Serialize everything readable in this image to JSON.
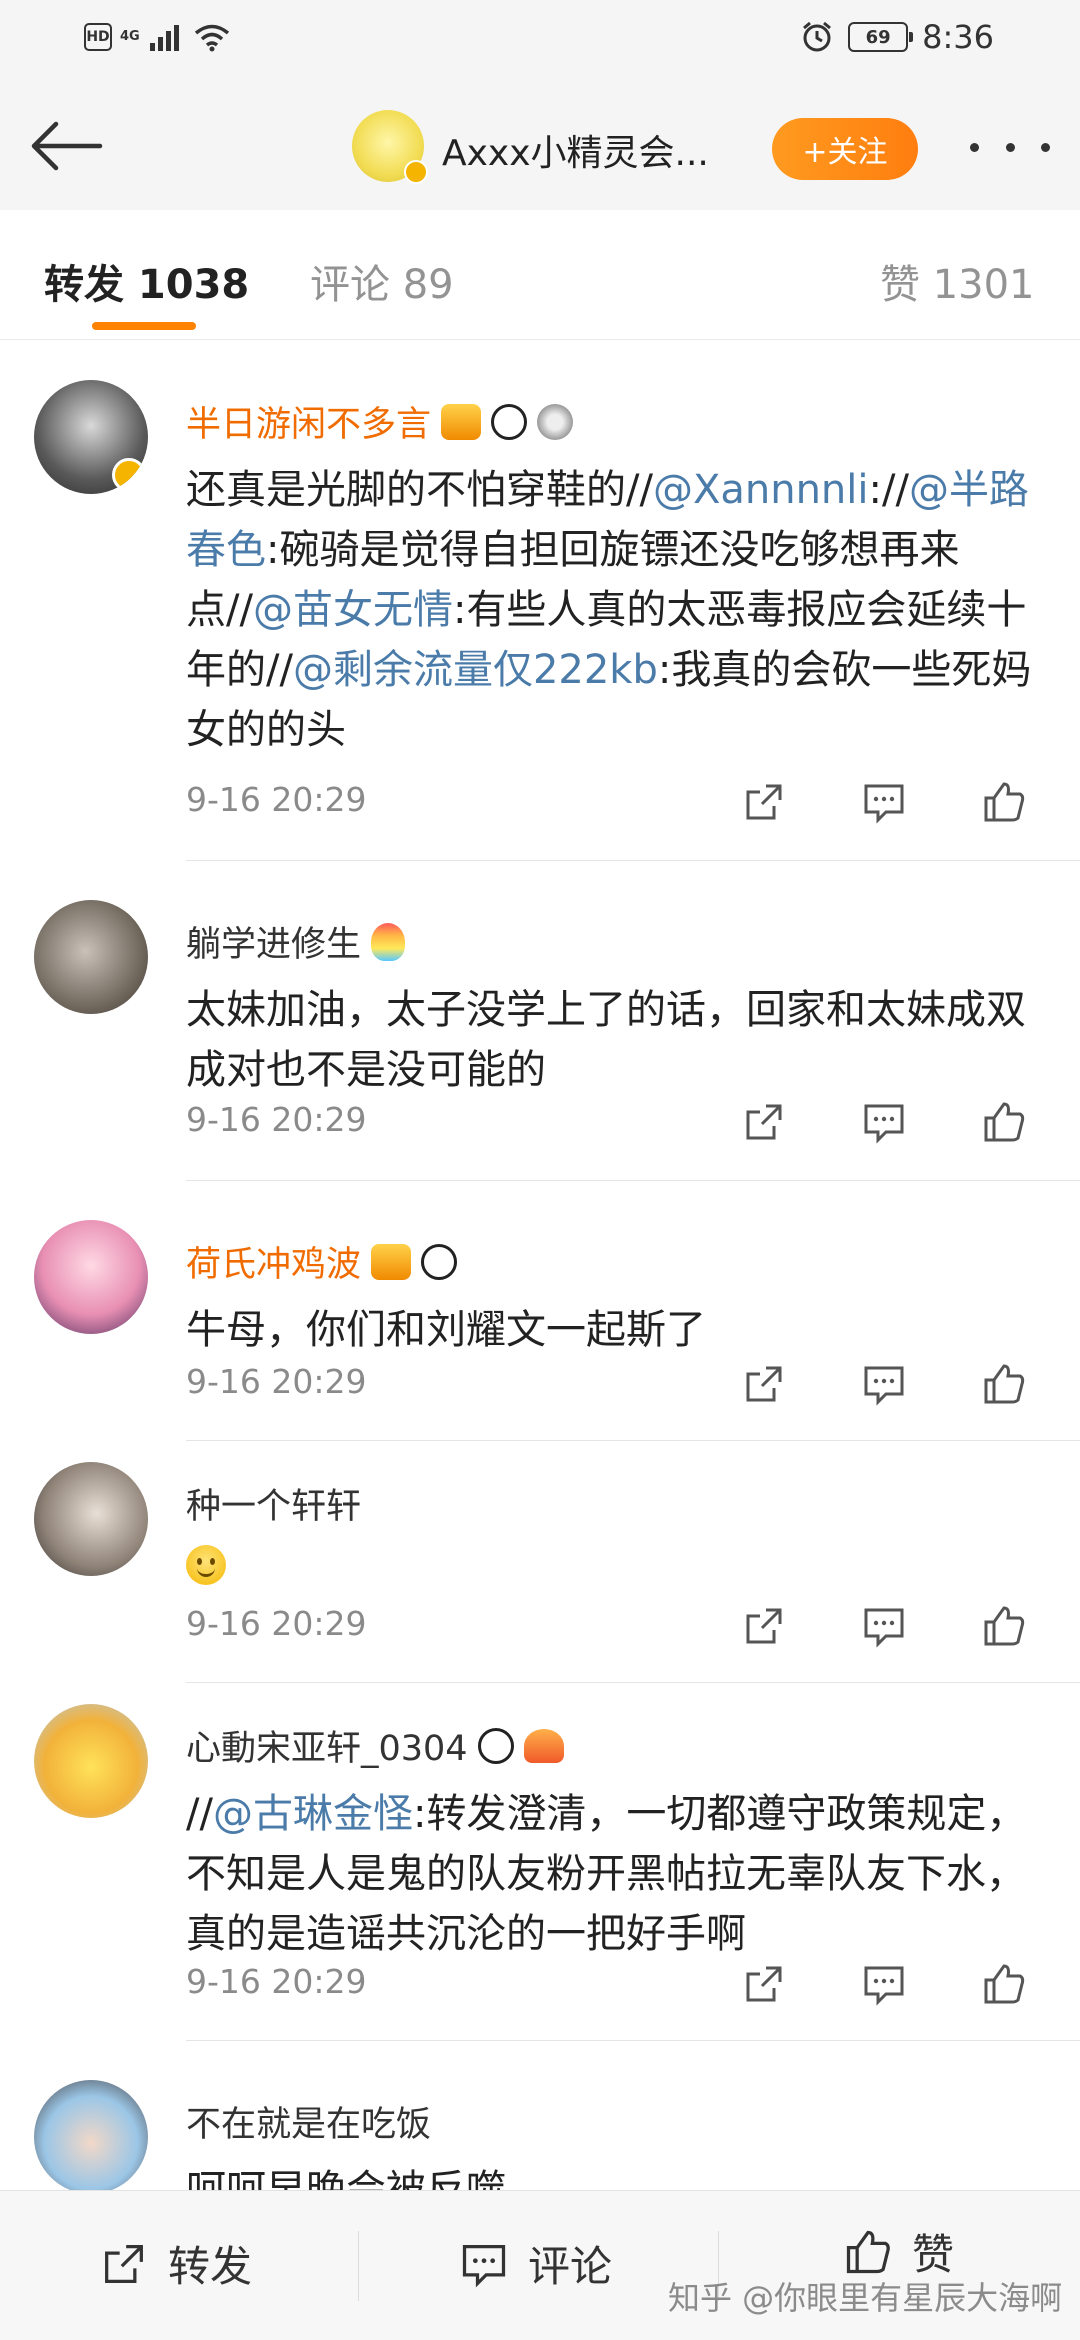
{
  "status_bar": {
    "hd": "HD",
    "network": "4G",
    "battery": "69",
    "time": "8:36"
  },
  "header": {
    "title": "Axxx小精灵会...",
    "follow_label": "+关注"
  },
  "tabs": [
    {
      "label": "转发 1038",
      "active": true
    },
    {
      "label": "评论 89",
      "active": false
    },
    {
      "label": "赞 1301",
      "active": false
    }
  ],
  "comments": [
    {
      "username": "半日游闲不多言",
      "vip": true,
      "segments": [
        {
          "t": "还真是光脚的不怕穿鞋的//"
        },
        {
          "t": "@Xannnnli",
          "m": true
        },
        {
          "t": "://"
        },
        {
          "t": "@半路春色",
          "m": true
        },
        {
          "t": ":碗骑是觉得自担回旋镖还没吃够想再来点//"
        },
        {
          "t": "@苗女无情",
          "m": true
        },
        {
          "t": ":有些人真的太恶毒报应会延续十年的//"
        },
        {
          "t": "@剩余流量仅222kb",
          "m": true
        },
        {
          "t": ":我真的会砍一些死妈女的的头"
        }
      ],
      "time": "9-16 20:29"
    },
    {
      "username": "躺学进修生",
      "vip": false,
      "segments": [
        {
          "t": "太妹加油，太子没学上了的话，回家和太妹成双成对也不是没可能的"
        }
      ],
      "time": "9-16 20:29"
    },
    {
      "username": "荷氏冲鸡波",
      "vip": true,
      "segments": [
        {
          "t": "牛母，你们和刘耀文一起斯了"
        }
      ],
      "time": "9-16 20:29"
    },
    {
      "username": "种一个轩轩",
      "vip": false,
      "segments": [],
      "emoji": "smiley",
      "time": "9-16 20:29"
    },
    {
      "username": "心動宋亚轩_0304",
      "vip": false,
      "segments": [
        {
          "t": "//"
        },
        {
          "t": "@古琳金怪",
          "m": true
        },
        {
          "t": ":转发澄清，一切都遵守政策规定，不知是人是鬼的队友粉开黑帖拉无辜队友下水，真的是造谣共沉沦的一把好手啊"
        }
      ],
      "time": "9-16 20:29"
    },
    {
      "username": "不在就是在吃饭",
      "vip": false,
      "segments": [
        {
          "t": "呵呵早晚会被反噬"
        }
      ],
      "time": ""
    }
  ],
  "bottom_bar": {
    "repost_label": "转发",
    "comment_label": "评论",
    "like_label": "赞",
    "watermark": "知乎 @你眼里有星辰大海啊"
  },
  "colors": {
    "accent": "#ff8200",
    "mention": "#4a7ba9",
    "vip_name": "#f06c00"
  }
}
